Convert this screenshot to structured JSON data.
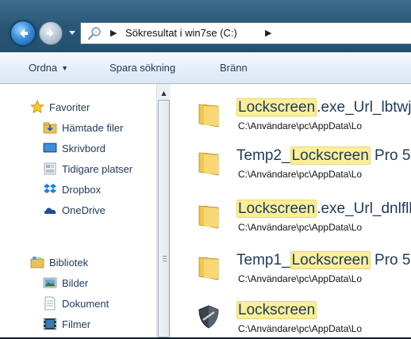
{
  "address_bar": {
    "path_label": "Sökresultat i win7se (C:)"
  },
  "toolbar": {
    "organize_label": "Ordna",
    "save_search_label": "Spara sökning",
    "burn_label": "Bränn"
  },
  "nav": {
    "favorites_header": "Favoriter",
    "favorites": [
      {
        "label": "Hämtade filer",
        "icon": "downloads-folder-icon"
      },
      {
        "label": "Skrivbord",
        "icon": "desktop-icon"
      },
      {
        "label": "Tidigare platser",
        "icon": "recent-places-icon"
      },
      {
        "label": "Dropbox",
        "icon": "dropbox-icon"
      },
      {
        "label": "OneDrive",
        "icon": "onedrive-icon"
      }
    ],
    "libraries_header": "Bibliotek",
    "libraries": [
      {
        "label": "Bilder",
        "icon": "pictures-library-icon"
      },
      {
        "label": "Dokument",
        "icon": "documents-library-icon"
      },
      {
        "label": "Filmer",
        "icon": "videos-library-icon"
      }
    ]
  },
  "results": [
    {
      "pre": "",
      "match": "Lockscreen",
      "post": ".exe_Url_lbtwj",
      "path": "C:\\Användare\\pc\\AppData\\Lo",
      "icon": "folder-icon"
    },
    {
      "pre": "Temp2_",
      "match": "Lockscreen",
      "post": " Pro 5",
      "path": "C:\\Användare\\pc\\AppData\\Lo",
      "icon": "folder-icon"
    },
    {
      "pre": "",
      "match": "Lockscreen",
      "post": ".exe_Url_dnlfll",
      "path": "C:\\Användare\\pc\\AppData\\Lo",
      "icon": "folder-icon"
    },
    {
      "pre": "Temp1_",
      "match": "Lockscreen",
      "post": " Pro 5",
      "path": "C:\\Användare\\pc\\AppData\\Lo",
      "icon": "folder-icon"
    },
    {
      "pre": "",
      "match": "Lockscreen",
      "post": "",
      "path": "C:\\Användare\\pc\\AppData\\Lo",
      "icon": "shield-icon"
    }
  ],
  "colors": {
    "highlight": "#fbef99",
    "nav_text": "#1e395b",
    "toolbar_bg": "#e5eef8"
  }
}
